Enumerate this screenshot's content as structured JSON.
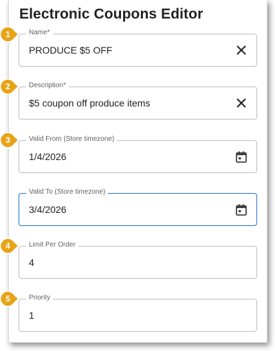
{
  "editor": {
    "title": "Electronic Coupons Editor"
  },
  "fields": {
    "name": {
      "label": "Name*",
      "value": "PRODUCE $5 OFF",
      "action_icon": "close-icon"
    },
    "description": {
      "label": "Description*",
      "value": "$5 coupon off produce items",
      "action_icon": "close-icon"
    },
    "valid_from": {
      "label": "Valid From (Store timezone)",
      "value": "1/4/2026",
      "action_icon": "calendar-icon"
    },
    "valid_to": {
      "label": "Valid To (Store timezone)",
      "value": "3/4/2026",
      "action_icon": "calendar-icon"
    },
    "limit_per_order": {
      "label": "Limit Per Order",
      "value": "4"
    },
    "priority": {
      "label": "Priority",
      "value": "1"
    }
  },
  "callouts": [
    "1",
    "2",
    "3",
    "4",
    "5"
  ],
  "colors": {
    "callout": "#e8a317",
    "focus_border": "#1e74c8",
    "field_border": "#bdbdbd",
    "text": "#212121",
    "label": "#616161"
  }
}
